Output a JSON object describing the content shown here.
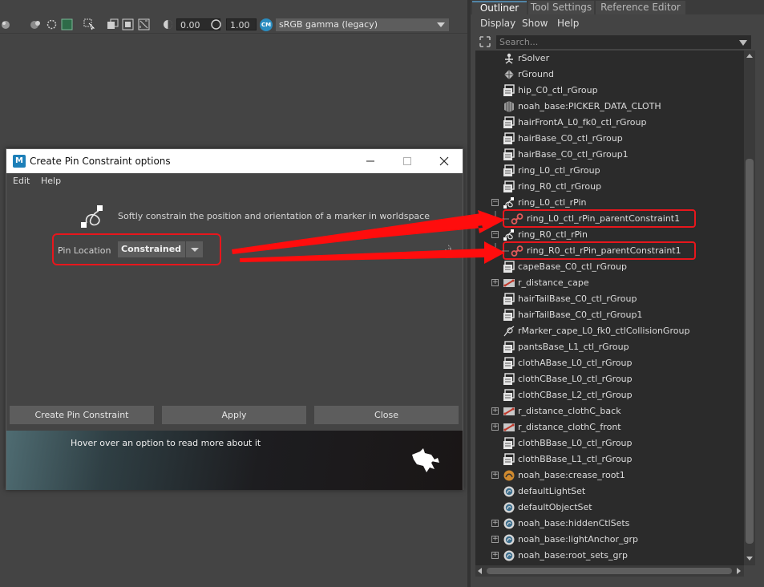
{
  "toolbar": {
    "exposure_value": "0.00",
    "gamma_value": "1.00",
    "colorspace_badge": "CM",
    "colorspace_label": "sRGB gamma (legacy)"
  },
  "outliner": {
    "tabs": [
      {
        "label": "Outliner",
        "active": true
      },
      {
        "label": "Tool Settings",
        "active": false
      },
      {
        "label": "Reference Editor",
        "active": false
      }
    ],
    "menus": [
      "Display",
      "Show",
      "Help"
    ],
    "search_placeholder": "Search...",
    "items": [
      {
        "label": "rSolver",
        "icon": "solver-icon",
        "expand": false,
        "indent": 0
      },
      {
        "label": "rGround",
        "icon": "ground-icon",
        "expand": false,
        "indent": 0
      },
      {
        "label": "hip_C0_ctl_rGroup",
        "icon": "group-icon",
        "expand": false,
        "indent": 0
      },
      {
        "label": "noah_base:PICKER_DATA_CLOTH",
        "icon": "data-icon",
        "expand": false,
        "indent": 0
      },
      {
        "label": "hairFrontA_L0_fk0_ctl_rGroup",
        "icon": "group-icon",
        "expand": false,
        "indent": 0
      },
      {
        "label": "hairBase_C0_ctl_rGroup",
        "icon": "group-icon",
        "expand": false,
        "indent": 0
      },
      {
        "label": "hairBase_C0_ctl_rGroup1",
        "icon": "group-icon",
        "expand": false,
        "indent": 0
      },
      {
        "label": "ring_L0_ctl_rGroup",
        "icon": "group-icon",
        "expand": false,
        "indent": 0
      },
      {
        "label": "ring_R0_ctl_rGroup",
        "icon": "group-icon",
        "expand": false,
        "indent": 0
      },
      {
        "label": "ring_L0_ctl_rPin",
        "icon": "pin-icon",
        "expand": true,
        "indent": 0
      },
      {
        "label": "ring_L0_ctl_rPin_parentConstraint1",
        "icon": "constraint-icon",
        "expand": false,
        "indent": 1,
        "highlight": true
      },
      {
        "label": "ring_R0_ctl_rPin",
        "icon": "pin-icon",
        "expand": true,
        "indent": 0
      },
      {
        "label": "ring_R0_ctl_rPin_parentConstraint1",
        "icon": "constraint-icon",
        "expand": false,
        "indent": 1,
        "highlight": true
      },
      {
        "label": "capeBase_C0_ctl_rGroup",
        "icon": "group-icon",
        "expand": false,
        "indent": 0
      },
      {
        "label": "r_distance_cape",
        "icon": "distance-icon",
        "expand": true,
        "indent": 0
      },
      {
        "label": "hairTailBase_C0_ctl_rGroup",
        "icon": "group-icon",
        "expand": false,
        "indent": 0
      },
      {
        "label": "hairTailBase_C0_ctl_rGroup1",
        "icon": "group-icon",
        "expand": false,
        "indent": 0
      },
      {
        "label": "rMarker_cape_L0_fk0_ctlCollisionGroup",
        "icon": "marker-icon",
        "expand": false,
        "indent": 0
      },
      {
        "label": "pantsBase_L1_ctl_rGroup",
        "icon": "group-icon",
        "expand": false,
        "indent": 0
      },
      {
        "label": "clothABase_L0_ctl_rGroup",
        "icon": "group-icon",
        "expand": false,
        "indent": 0
      },
      {
        "label": "clothCBase_L0_ctl_rGroup",
        "icon": "group-icon",
        "expand": false,
        "indent": 0
      },
      {
        "label": "clothCBase_L2_ctl_rGroup",
        "icon": "group-icon",
        "expand": false,
        "indent": 0
      },
      {
        "label": "r_distance_clothC_back",
        "icon": "distance-icon",
        "expand": true,
        "indent": 0
      },
      {
        "label": "r_distance_clothC_front",
        "icon": "distance-icon",
        "expand": true,
        "indent": 0
      },
      {
        "label": "clothBBase_L0_ctl_rGroup",
        "icon": "group-icon",
        "expand": false,
        "indent": 0
      },
      {
        "label": "clothBBase_L1_ctl_rGroup",
        "icon": "group-icon",
        "expand": false,
        "indent": 0
      },
      {
        "label": "noah_base:crease_root1",
        "icon": "crease-icon",
        "expand": true,
        "indent": 0
      },
      {
        "label": "defaultLightSet",
        "icon": "set-icon",
        "expand": false,
        "indent": 0
      },
      {
        "label": "defaultObjectSet",
        "icon": "set-icon",
        "expand": false,
        "indent": 0
      },
      {
        "label": "noah_base:hiddenCtlSets",
        "icon": "set-icon",
        "expand": true,
        "indent": 0
      },
      {
        "label": "noah_base:lightAnchor_grp",
        "icon": "set-icon",
        "expand": true,
        "indent": 0
      },
      {
        "label": "noah_base:root_sets_grp",
        "icon": "set-icon",
        "expand": true,
        "indent": 0
      }
    ]
  },
  "dialog": {
    "app_icon": "M",
    "title": "Create Pin Constraint options",
    "menus": [
      "Edit",
      "Help"
    ],
    "description": "Softly constrain the position and orientation of a marker in worldspace",
    "pin_location_label": "Pin Location",
    "pin_location_value": "Constrained",
    "buttons": {
      "create": "Create Pin Constraint",
      "apply": "Apply",
      "close": "Close"
    },
    "help_text": "Hover over an option to read more about it"
  },
  "colors": {
    "annotation_red": "#e8161c",
    "tab_accent": "#5285a6",
    "panel_bg": "#444444",
    "list_bg": "#2b2b2b"
  }
}
